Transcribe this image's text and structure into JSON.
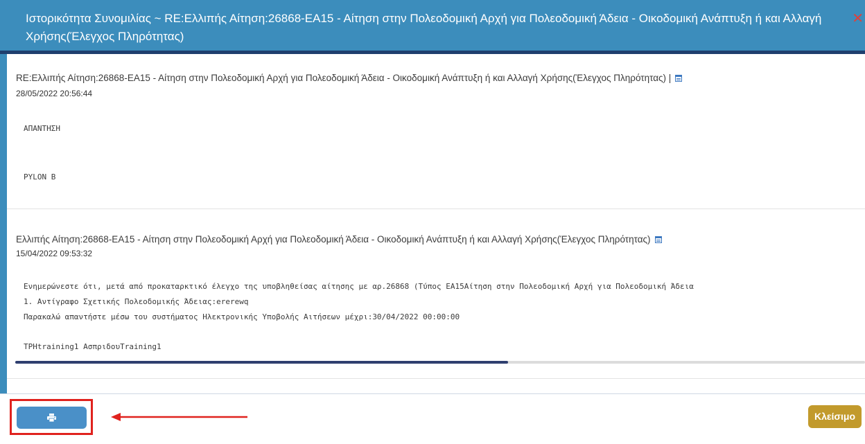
{
  "dialog": {
    "title": "Ιστορικότητα Συνομιλίας ~ RE:Ελλιπής Αίτηση:26868-ΕΑ15 - Αίτηση στην Πολεοδομική Αρχή για Πολεοδομική Άδεια - Οικοδομική Ανάπτυξη ή και Αλλαγή Χρήσης(Έλεγχος Πληρότητας)",
    "close_glyph": "✕"
  },
  "messages": [
    {
      "subject": "RE:Ελλιπής Αίτηση:26868-ΕΑ15 - Αίτηση στην Πολεοδομική Αρχή για Πολεοδομική Άδεια - Οικοδομική Ανάπτυξη ή και Αλλαγή Χρήσης(Έλεγχος Πληρότητας) |",
      "date": "28/05/2022 20:56:44",
      "lines": [
        "ΑΠΑΝΤΗΣΗ",
        "PYLON B"
      ]
    },
    {
      "subject": "Ελλιπής Αίτηση:26868-ΕΑ15 - Αίτηση στην Πολεοδομική Αρχή για Πολεοδομική Άδεια - Οικοδομική Ανάπτυξη ή και Αλλαγή Χρήσης(Έλεγχος Πληρότητας)",
      "date": "15/04/2022 09:53:32",
      "lines": [
        "Ενημερώνεστε ότι, μετά από προκαταρκτικό έλεγχο της υποβληθείσας αίτησης με αρ.26868 (Τύπος ΕΑ15Αίτηση στην Πολεοδομική Αρχή για Πολεοδομική Άδεια",
        "1. Αντίγραφο Σχετικής Πολεοδομικής Άδειας:ererewq",
        "Παρακαλώ απαντήστε μέσω του συστήματος Ηλεκτρονικής Υποβολής Αιτήσεων μέχρι:30/04/2022 00:00:00",
        "TPHtraining1 ΑσπριδουTraining1"
      ]
    }
  ],
  "scroll": {
    "position_fraction": 0.58
  },
  "footer": {
    "close_label": "Κλείσιμο"
  },
  "colors": {
    "header": "#3c8dbc",
    "print_button": "#4a90c8",
    "close_button": "#c29a2c",
    "annotation": "#e0221e"
  },
  "icons": {
    "print": "printer-icon",
    "calendar": "calendar-icon"
  }
}
